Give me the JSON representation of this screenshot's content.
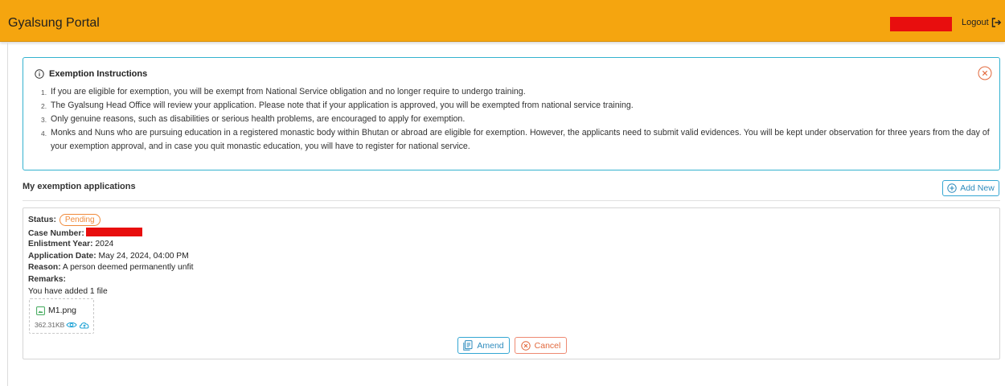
{
  "header": {
    "title": "Gyalsung Portal",
    "logout_label": "Logout",
    "bg_color": "#f5a50f"
  },
  "instructions": {
    "title": "Exemption Instructions",
    "items": [
      {
        "num": "1.",
        "text": "If you are eligible for exemption, you will be exempt from National Service obligation and no longer require to undergo training."
      },
      {
        "num": "2.",
        "text": "The Gyalsung Head Office will review your application. Please note that if your application is approved, you will be exempted from national service training."
      },
      {
        "num": "3.",
        "text": "Only genuine reasons, such as disabilities or serious health problems, are encouraged to apply for exemption."
      },
      {
        "num": "4.",
        "text": "Monks and Nuns who are pursuing education in a registered monastic body within Bhutan or abroad are eligible for exemption. However, the applicants need to submit valid evidences. You will be kept under observation for three years from the day of your exemption approval, and in case you quit monastic education, you will have to register for national service."
      }
    ],
    "accent_color": "#34b2cf"
  },
  "applications": {
    "section_title": "My exemption applications",
    "add_new_label": "Add New",
    "card": {
      "status_label": "Status:",
      "status_value": "Pending",
      "case_label": "Case Number:",
      "enlistment_label": "Enlistment Year:",
      "enlistment_value": "2024",
      "date_label": "Application Date:",
      "date_value": "May 24, 2024, 04:00 PM",
      "reason_label": "Reason:",
      "reason_value": "A person deemed permanently unfit",
      "remarks_label": "Remarks:",
      "files_note": "You have added 1 file",
      "file": {
        "name": "M1.png",
        "size": "362.31KB"
      },
      "amend_label": "Amend",
      "cancel_label": "Cancel"
    }
  },
  "colors": {
    "pending": "#f08a3a",
    "primary": "#34a6d3",
    "danger": "#e2693d",
    "redaction": "#e80e0e"
  }
}
